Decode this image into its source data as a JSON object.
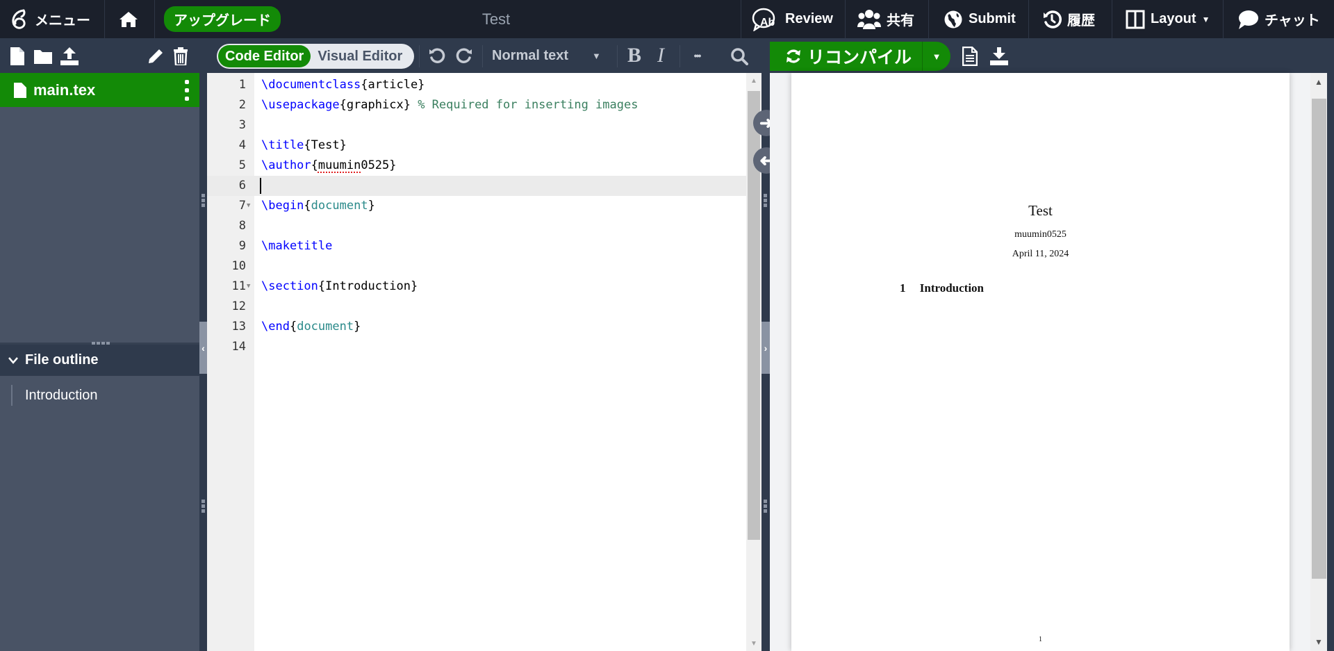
{
  "topbar": {
    "menu_label": "メニュー",
    "upgrade_label": "アップグレード",
    "project_title": "Test",
    "review_label": "Review",
    "share_label": "共有",
    "submit_label": "Submit",
    "history_label": "履歴",
    "layout_label": "Layout",
    "chat_label": "チャット"
  },
  "toolbar": {
    "code_editor_label": "Code Editor",
    "visual_editor_label": "Visual Editor",
    "text_style_value": "Normal text",
    "bold_label": "B",
    "italic_label": "I",
    "more_label": "•••",
    "recompile_label": "リコンパイル"
  },
  "sidebar": {
    "active_file": "main.tex",
    "outline_title": "File outline",
    "outline_items": [
      "Introduction"
    ]
  },
  "editor": {
    "lines": [
      {
        "n": "1",
        "parts": [
          [
            "kw",
            "\\documentclass"
          ],
          [
            "",
            "{article}"
          ]
        ]
      },
      {
        "n": "2",
        "parts": [
          [
            "kw",
            "\\usepackage"
          ],
          [
            "",
            "{graphicx} "
          ],
          [
            "cm",
            "% Required for inserting images"
          ]
        ]
      },
      {
        "n": "3",
        "parts": []
      },
      {
        "n": "4",
        "parts": [
          [
            "kw",
            "\\title"
          ],
          [
            "",
            "{Test}"
          ]
        ]
      },
      {
        "n": "5",
        "parts": [
          [
            "kw",
            "\\author"
          ],
          [
            "",
            "{"
          ],
          [
            "spell",
            "muumin"
          ],
          [
            "",
            "0525}"
          ]
        ]
      },
      {
        "n": "6",
        "parts": [],
        "active": true
      },
      {
        "n": "7",
        "fold": true,
        "parts": [
          [
            "kw",
            "\\begin"
          ],
          [
            "",
            "{"
          ],
          [
            "env",
            "document"
          ],
          [
            "",
            "}"
          ]
        ]
      },
      {
        "n": "8",
        "parts": []
      },
      {
        "n": "9",
        "parts": [
          [
            "kw",
            "\\maketitle"
          ]
        ]
      },
      {
        "n": "10",
        "parts": []
      },
      {
        "n": "11",
        "fold": true,
        "parts": [
          [
            "kw",
            "\\section"
          ],
          [
            "",
            "{Introduction}"
          ]
        ]
      },
      {
        "n": "12",
        "parts": []
      },
      {
        "n": "13",
        "parts": [
          [
            "kw",
            "\\end"
          ],
          [
            "",
            "{"
          ],
          [
            "env",
            "document"
          ],
          [
            "",
            "}"
          ]
        ]
      },
      {
        "n": "14",
        "parts": []
      }
    ]
  },
  "pdf": {
    "title": "Test",
    "author": "muumin0525",
    "date": "April 11, 2024",
    "section_number": "1",
    "section_title": "Introduction",
    "page_number": "1"
  },
  "colors": {
    "accent_green": "#138a07",
    "topbar_bg": "#1b202b",
    "toolbar_bg": "#2f3a4c",
    "sidebar_bg": "#495365"
  }
}
